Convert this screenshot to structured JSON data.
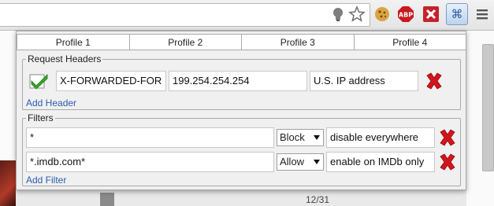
{
  "popup": {
    "tabs": [
      {
        "label": "Profile 1"
      },
      {
        "label": "Profile 2"
      },
      {
        "label": "Profile 3"
      },
      {
        "label": "Profile 4"
      }
    ],
    "request_headers": {
      "legend": "Request Headers",
      "rows": [
        {
          "enabled": true,
          "name": "X-FORWARDED-FOR",
          "value": "199.254.254.254",
          "comment": "U.S. IP address"
        }
      ],
      "add_label": "Add Header"
    },
    "filters": {
      "legend": "Filters",
      "rows": [
        {
          "pattern": "*",
          "action": "Block",
          "comment": "disable everywhere"
        },
        {
          "pattern": "*.imdb.com*",
          "action": "Allow",
          "comment": "enable on IMDb only"
        }
      ],
      "add_label": "Add Filter"
    }
  },
  "page": {
    "counter": "12/31"
  },
  "colors": {
    "accent_link": "#2a5db0",
    "delete_red": "#d4141c",
    "check_green": "#3aa52a"
  },
  "icons": [
    "bulb-icon",
    "star-icon",
    "cookie-icon",
    "adblock-icon",
    "puzzle-icon",
    "modheader-icon",
    "menu-icon"
  ]
}
